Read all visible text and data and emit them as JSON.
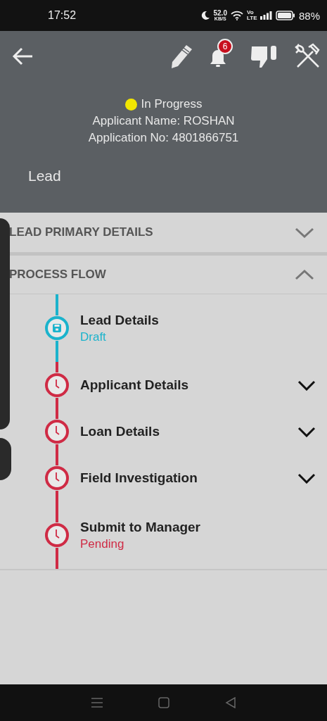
{
  "status_bar": {
    "time": "17:52",
    "speed_value": "52.0",
    "speed_unit": "KB/S",
    "network_label": "Vo LTE",
    "battery": "88%"
  },
  "toolbar": {
    "notification_count": "6"
  },
  "summary": {
    "status": {
      "label": "In Progress",
      "color": "#f2e600"
    },
    "applicant": "Applicant Name: ROSHAN",
    "application_no": "Application No: 4801866751",
    "title": "Lead"
  },
  "sections": [
    {
      "label": "LEAD PRIMARY DETAILS",
      "expanded": false
    },
    {
      "label": "PROCESS FLOW",
      "expanded": true
    }
  ],
  "steps": [
    {
      "title": "Lead Details",
      "status": "Draft",
      "kind": "draft",
      "expandable": false
    },
    {
      "title": "Applicant Details",
      "kind": "pending",
      "expandable": true
    },
    {
      "title": "Loan Details",
      "kind": "pending",
      "expandable": true
    },
    {
      "title": "Field Investigation",
      "kind": "pending",
      "expandable": true
    },
    {
      "title": "Submit to Manager",
      "status": "Pending",
      "kind": "pending",
      "expandable": false
    }
  ]
}
